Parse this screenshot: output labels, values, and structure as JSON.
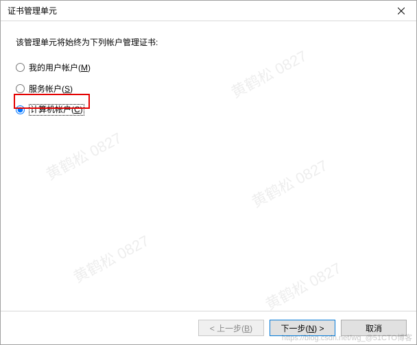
{
  "titlebar": {
    "title": "证书管理单元"
  },
  "body": {
    "prompt": "该管理单元将始终为下列帐户管理证书:",
    "options": {
      "user_prefix": "我的用户帐户(",
      "user_hotkey": "M",
      "user_suffix": ")",
      "service_prefix": "服务帐户(",
      "service_hotkey": "S",
      "service_suffix": ")",
      "computer_prefix": "计算机帐户(",
      "computer_hotkey": "C",
      "computer_suffix": ")"
    },
    "selected": "computer"
  },
  "footer": {
    "back_prefix": "< 上一步(",
    "back_hotkey": "B",
    "back_suffix": ")",
    "next_prefix": "下一步(",
    "next_hotkey": "N",
    "next_suffix": ") >",
    "cancel": "取消"
  },
  "watermark": {
    "text": "黄鹤松 0827",
    "footer_text": "https://blog.csdn.net/wg_@51CTO博客"
  }
}
